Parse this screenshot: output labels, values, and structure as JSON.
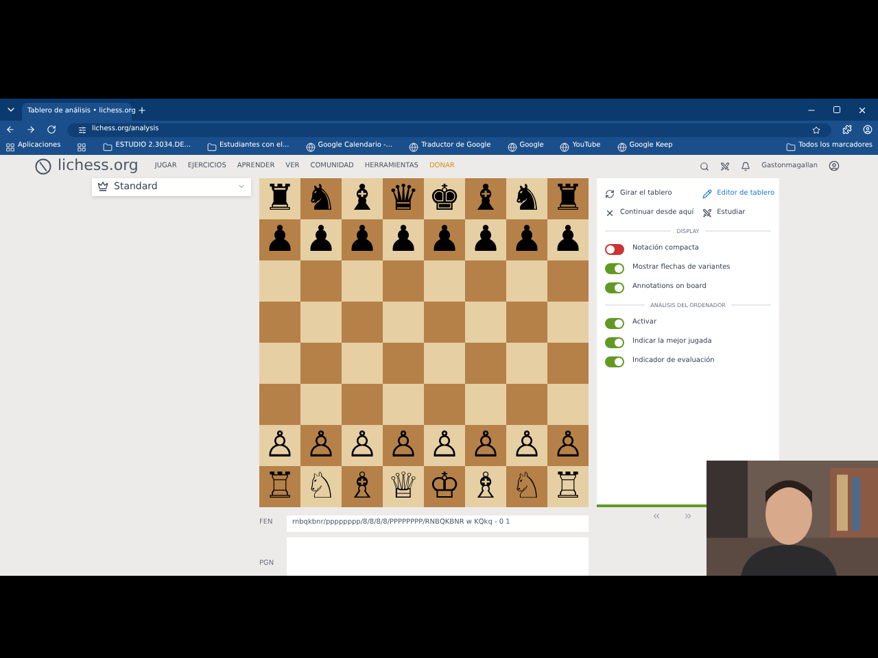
{
  "browser": {
    "tab_title": "Tablero de análisis • lichess.org",
    "url": "lichess.org/analysis",
    "bookmarks": [
      {
        "kind": "apps",
        "label": "Aplicaciones"
      },
      {
        "kind": "grid"
      },
      {
        "kind": "folder",
        "label": "ESTUDIO 2.3034.DE..."
      },
      {
        "kind": "folder",
        "label": "Estudiantes con el..."
      },
      {
        "kind": "site",
        "label": "Google Calendario -..."
      },
      {
        "kind": "site",
        "label": "Traductor de Google"
      },
      {
        "kind": "site",
        "label": "Google"
      },
      {
        "kind": "site",
        "label": "YouTube"
      },
      {
        "kind": "site",
        "label": "Google Keep"
      }
    ],
    "all_bookmarks": "Todos los marcadores"
  },
  "site": {
    "logo": "lichess.org",
    "nav": [
      {
        "label": "JUGAR",
        "highlight": false
      },
      {
        "label": "EJERCICIOS",
        "highlight": false
      },
      {
        "label": "APRENDER",
        "highlight": false
      },
      {
        "label": "VER",
        "highlight": false
      },
      {
        "label": "COMUNIDAD",
        "highlight": false
      },
      {
        "label": "HERRAMIENTAS",
        "highlight": false
      },
      {
        "label": "DONAR",
        "highlight": true
      }
    ],
    "username": "Gastonmagallan"
  },
  "variant": "Standard",
  "board": {
    "rows": [
      [
        "♜",
        "♞",
        "♝",
        "♛",
        "♚",
        "♝",
        "♞",
        "♜"
      ],
      [
        "♟",
        "♟",
        "♟",
        "♟",
        "♟",
        "♟",
        "♟",
        "♟"
      ],
      [
        null,
        null,
        null,
        null,
        null,
        null,
        null,
        null
      ],
      [
        null,
        null,
        null,
        null,
        null,
        null,
        null,
        null
      ],
      [
        null,
        null,
        null,
        null,
        null,
        null,
        null,
        null
      ],
      [
        null,
        null,
        null,
        null,
        null,
        null,
        null,
        null
      ],
      [
        "♙",
        "♙",
        "♙",
        "♙",
        "♙",
        "♙",
        "♙",
        "♙"
      ],
      [
        "♖",
        "♘",
        "♗",
        "♕",
        "♔",
        "♗",
        "♘",
        "♖"
      ]
    ]
  },
  "tools": [
    {
      "kind": "rotate",
      "label": "Girar el tablero",
      "link": false
    },
    {
      "kind": "edit",
      "label": "Editor de tablero",
      "link": true
    },
    {
      "kind": "cross",
      "label": "Continuar desde aquí",
      "link": false
    },
    {
      "kind": "study",
      "label": "Estudiar",
      "link": false
    }
  ],
  "sections": [
    {
      "title": "DISPLAY",
      "toggles": [
        {
          "label": "Notación compacta",
          "on": false
        },
        {
          "label": "Mostrar flechas de variantes",
          "on": true
        },
        {
          "label": "Annotations on board",
          "on": true
        }
      ]
    },
    {
      "title": "ANÁLISIS DEL ORDENADOR",
      "toggles": [
        {
          "label": "Activar",
          "on": true
        },
        {
          "label": "Indicar la mejor jugada",
          "on": true
        },
        {
          "label": "Indicador de evaluación",
          "on": true
        }
      ]
    }
  ],
  "fen": {
    "label": "FEN",
    "value": "rnbqkbnr/pppppppp/8/8/8/8/PPPPPPPP/RNBQKBNR w KQkq - 0 1"
  },
  "pgn": {
    "label": "PGN"
  }
}
